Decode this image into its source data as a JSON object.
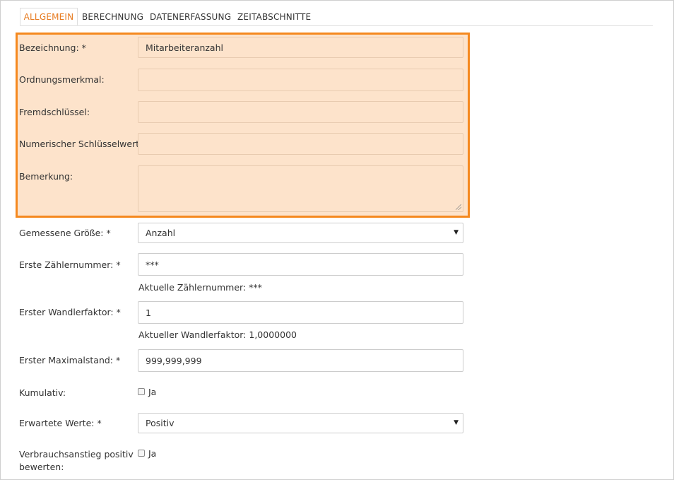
{
  "tabs": [
    {
      "label": "ALLGEMEIN",
      "active": true
    },
    {
      "label": "BERECHNUNG",
      "active": false
    },
    {
      "label": "DATENERFASSUNG",
      "active": false
    },
    {
      "label": "ZEITABSCHNITTE",
      "active": false
    }
  ],
  "form": {
    "bezeichnung": {
      "label": "Bezeichnung: *",
      "value": "Mitarbeiteranzahl"
    },
    "ordnungsmerkmal": {
      "label": "Ordnungsmerkmal:",
      "value": ""
    },
    "fremdschluessel": {
      "label": "Fremdschlüssel:",
      "value": ""
    },
    "numerischer_schluesselwert": {
      "label": "Numerischer Schlüsselwert:",
      "value": ""
    },
    "bemerkung": {
      "label": "Bemerkung:",
      "value": ""
    },
    "gemessene_groesse": {
      "label": "Gemessene Größe: *",
      "value": "Anzahl"
    },
    "erste_zaehlernummer": {
      "label": "Erste Zählernummer: *",
      "value": "***",
      "help": "Aktuelle Zählernummer: ***"
    },
    "erster_wandlerfaktor": {
      "label": "Erster Wandlerfaktor: *",
      "value": "1",
      "help": "Aktueller Wandlerfaktor: 1,0000000"
    },
    "erster_maximalstand": {
      "label": "Erster Maximalstand: *",
      "value": "999,999,999"
    },
    "kumulativ": {
      "label": "Kumulativ:",
      "checkbox_label": "Ja",
      "checked": false
    },
    "erwartete_werte": {
      "label": "Erwartete Werte: *",
      "value": "Positiv"
    },
    "verbrauchsanstieg": {
      "label_line1": "Verbrauchsanstieg positiv",
      "label_line2": "bewerten:",
      "checkbox_label": "Ja",
      "checked": false
    }
  },
  "colors": {
    "accent": "#f5891f",
    "highlight_bg": "#fde3cb",
    "tab_active": "#e77a1e"
  }
}
